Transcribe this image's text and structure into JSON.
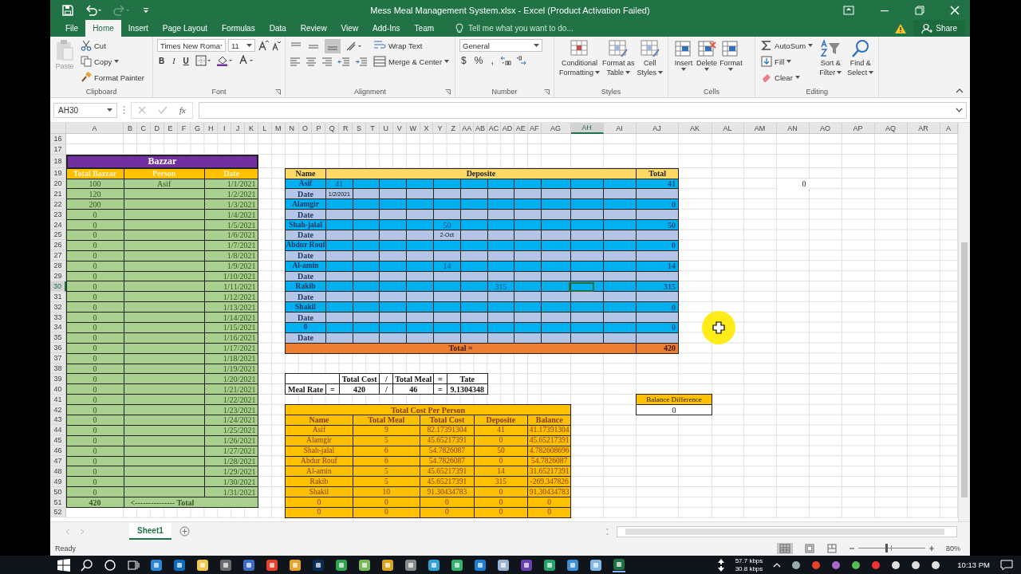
{
  "title_bar": {
    "title": "Mess Meal Management System.xlsx - Excel (Product Activation Failed)"
  },
  "tabs": [
    {
      "label": "File",
      "selected": false
    },
    {
      "label": "Home",
      "selected": true
    },
    {
      "label": "Insert",
      "selected": false
    },
    {
      "label": "Page Layout",
      "selected": false
    },
    {
      "label": "Formulas",
      "selected": false
    },
    {
      "label": "Data",
      "selected": false
    },
    {
      "label": "Review",
      "selected": false
    },
    {
      "label": "View",
      "selected": false
    },
    {
      "label": "Add-Ins",
      "selected": false
    },
    {
      "label": "Team",
      "selected": false
    }
  ],
  "tell_me": {
    "placeholder": "Tell me what you want to do..."
  },
  "share": "Share",
  "ribbon": {
    "clipboard": {
      "label": "Clipboard",
      "paste": "Paste",
      "cut": "Cut",
      "copy": "Copy",
      "format_painter": "Format Painter"
    },
    "font": {
      "label": "Font",
      "font_name": "Times New Roma",
      "font_size": "11",
      "bold": "B",
      "italic": "I",
      "underline": "U"
    },
    "alignment": {
      "label": "Alignment",
      "wrap_text": "Wrap Text",
      "merge_center": "Merge & Center"
    },
    "number": {
      "label": "Number",
      "format": "General",
      "currency": "$",
      "percent": "%",
      "comma": ","
    },
    "styles": {
      "label": "Styles",
      "buttons": [
        [
          "Conditional",
          "Formatting"
        ],
        [
          "Format as",
          "Table"
        ],
        [
          "Cell",
          "Styles"
        ]
      ]
    },
    "cells": {
      "label": "Cells",
      "buttons": [
        "Insert",
        "Delete",
        "Format"
      ]
    },
    "editing": {
      "label": "Editing",
      "autosum": "AutoSum",
      "fill": "Fill",
      "clear": "Clear",
      "buttons": [
        [
          "Sort &",
          "Filter"
        ],
        [
          "Find &",
          "Select"
        ]
      ]
    }
  },
  "formula_bar": {
    "name_box": "AH30",
    "fx": "fx"
  },
  "sheet": {
    "columns": [
      {
        "label": "A",
        "selected": false
      },
      {
        "label": "B",
        "selected": false
      },
      {
        "label": "C",
        "selected": false
      },
      {
        "label": "D",
        "selected": false
      },
      {
        "label": "E",
        "selected": false
      },
      {
        "label": "F",
        "selected": false
      },
      {
        "label": "G",
        "selected": false
      },
      {
        "label": "H",
        "selected": false
      },
      {
        "label": "I",
        "selected": false
      },
      {
        "label": "J",
        "selected": false
      },
      {
        "label": "K",
        "selected": false
      },
      {
        "label": "L",
        "selected": false
      },
      {
        "label": "M",
        "selected": false
      },
      {
        "label": "N",
        "selected": false
      },
      {
        "label": "O",
        "selected": false
      },
      {
        "label": "P",
        "selected": false
      },
      {
        "label": "Q",
        "selected": false
      },
      {
        "label": "R",
        "selected": false
      },
      {
        "label": "S",
        "selected": false
      },
      {
        "label": "T",
        "selected": false
      },
      {
        "label": "U",
        "selected": false
      },
      {
        "label": "V",
        "selected": false
      },
      {
        "label": "W",
        "selected": false
      },
      {
        "label": "X",
        "selected": false
      },
      {
        "label": "Y",
        "selected": false
      },
      {
        "label": "Z",
        "selected": false
      },
      {
        "label": "AA",
        "selected": false
      },
      {
        "label": "AB",
        "selected": false
      },
      {
        "label": "AC",
        "selected": false
      },
      {
        "label": "AD",
        "selected": false
      },
      {
        "label": "AE",
        "selected": false
      },
      {
        "label": "AF",
        "selected": false
      },
      {
        "label": "AG",
        "selected": false
      },
      {
        "label": "AH",
        "selected": true
      },
      {
        "label": "AI",
        "selected": false
      },
      {
        "label": "AJ",
        "selected": false
      },
      {
        "label": "AK",
        "selected": false
      },
      {
        "label": "AL",
        "selected": false
      },
      {
        "label": "AM",
        "selected": false
      },
      {
        "label": "AN",
        "selected": false
      },
      {
        "label": "AO",
        "selected": false
      },
      {
        "label": "AP",
        "selected": false
      },
      {
        "label": "AQ",
        "selected": false
      },
      {
        "label": "AR",
        "selected": false
      },
      {
        "label": "A",
        "selected": false
      }
    ],
    "rows": [
      {
        "label": "16",
        "selected": false
      },
      {
        "label": "17",
        "selected": false
      },
      {
        "label": "18",
        "selected": false
      },
      {
        "label": "19",
        "selected": false
      },
      {
        "label": "20",
        "selected": false
      },
      {
        "label": "21",
        "selected": false
      },
      {
        "label": "22",
        "selected": false
      },
      {
        "label": "23",
        "selected": false
      },
      {
        "label": "24",
        "selected": false
      },
      {
        "label": "25",
        "selected": false
      },
      {
        "label": "26",
        "selected": false
      },
      {
        "label": "27",
        "selected": false
      },
      {
        "label": "28",
        "selected": false
      },
      {
        "label": "29",
        "selected": false
      },
      {
        "label": "30",
        "selected": true
      },
      {
        "label": "31",
        "selected": false
      },
      {
        "label": "32",
        "selected": false
      },
      {
        "label": "33",
        "selected": false
      },
      {
        "label": "34",
        "selected": false
      },
      {
        "label": "35",
        "selected": false
      },
      {
        "label": "36",
        "selected": false
      },
      {
        "label": "37",
        "selected": false
      },
      {
        "label": "38",
        "selected": false
      },
      {
        "label": "39",
        "selected": false
      },
      {
        "label": "40",
        "selected": false
      },
      {
        "label": "41",
        "selected": false
      },
      {
        "label": "42",
        "selected": false
      },
      {
        "label": "43",
        "selected": false
      },
      {
        "label": "44",
        "selected": false
      },
      {
        "label": "45",
        "selected": false
      },
      {
        "label": "46",
        "selected": false
      },
      {
        "label": "47",
        "selected": false
      },
      {
        "label": "48",
        "selected": false
      },
      {
        "label": "49",
        "selected": false
      },
      {
        "label": "50",
        "selected": false
      },
      {
        "label": "51",
        "selected": false
      },
      {
        "label": "52",
        "selected": false
      }
    ],
    "loose_cell": {
      "value": "0"
    }
  },
  "bazzar": {
    "title": "Bazzar",
    "columns": [
      "Total Bazzar",
      "Person",
      "Date"
    ],
    "rows": [
      {
        "total": "100",
        "person": "Asif",
        "date": "1/1/2021"
      },
      {
        "total": "120",
        "date": "1/2/2021"
      },
      {
        "total": "200",
        "date": "1/3/2021"
      },
      {
        "total": "0",
        "date": "1/4/2021"
      },
      {
        "total": "0",
        "date": "1/5/2021"
      },
      {
        "total": "0",
        "date": "1/6/2021"
      },
      {
        "total": "0",
        "date": "1/7/2021"
      },
      {
        "total": "0",
        "date": "1/8/2021"
      },
      {
        "total": "0",
        "date": "1/9/2021"
      },
      {
        "total": "0",
        "date": "1/10/2021"
      },
      {
        "total": "0",
        "date": "1/11/2021"
      },
      {
        "total": "0",
        "date": "1/12/2021"
      },
      {
        "total": "0",
        "date": "1/13/2021"
      },
      {
        "total": "0",
        "date": "1/14/2021"
      },
      {
        "total": "0",
        "date": "1/15/2021"
      },
      {
        "total": "0",
        "date": "1/16/2021"
      },
      {
        "total": "0",
        "date": "1/17/2021"
      },
      {
        "total": "0",
        "date": "1/18/2021"
      },
      {
        "total": "0",
        "date": "1/19/2021"
      },
      {
        "total": "0",
        "date": "1/20/2021"
      },
      {
        "total": "0",
        "date": "1/21/2021"
      },
      {
        "total": "0",
        "date": "1/22/2021"
      },
      {
        "total": "0",
        "date": "1/23/2021"
      },
      {
        "total": "0",
        "date": "1/24/2021"
      },
      {
        "total": "0",
        "date": "1/25/2021"
      },
      {
        "total": "0",
        "date": "1/26/2021"
      },
      {
        "total": "0",
        "date": "1/27/2021"
      },
      {
        "total": "0",
        "date": "1/28/2021"
      },
      {
        "total": "0",
        "date": "1/29/2021"
      },
      {
        "total": "0",
        "date": "1/30/2021"
      },
      {
        "total": "0",
        "date": "1/31/2021"
      }
    ],
    "footer": {
      "total": "420",
      "label": "<--------------- Total"
    }
  },
  "deposit_table": {
    "headers": {
      "name": "Name",
      "deposit": "Deposite",
      "total": "Total"
    },
    "people": [
      {
        "name": "Asif",
        "amounts": [
          {
            "kind": "value",
            "value": "41"
          },
          {
            "kind": "blank"
          },
          {
            "kind": "blank"
          },
          {
            "kind": "blank"
          },
          {
            "kind": "blank"
          },
          {
            "kind": "blank"
          },
          {
            "kind": "blank"
          },
          {
            "kind": "blank"
          },
          {
            "kind": "blank"
          },
          {
            "kind": "blank"
          },
          {
            "kind": "blank"
          }
        ],
        "total": "41",
        "date_label": "Date",
        "dates": [
          {
            "kind": "value",
            "value": "1/2/2021"
          },
          {
            "kind": "blank"
          },
          {
            "kind": "blank"
          },
          {
            "kind": "blank"
          },
          {
            "kind": "blank"
          },
          {
            "kind": "blank"
          },
          {
            "kind": "blank"
          },
          {
            "kind": "blank"
          },
          {
            "kind": "blank"
          },
          {
            "kind": "blank"
          },
          {
            "kind": "blank"
          }
        ]
      },
      {
        "name": "Alamgir",
        "amounts": [
          {
            "kind": "blank"
          },
          {
            "kind": "blank"
          },
          {
            "kind": "blank"
          },
          {
            "kind": "blank"
          },
          {
            "kind": "blank"
          },
          {
            "kind": "blank"
          },
          {
            "kind": "blank"
          },
          {
            "kind": "blank"
          },
          {
            "kind": "blank"
          },
          {
            "kind": "blank"
          },
          {
            "kind": "blank"
          }
        ],
        "total": "0",
        "date_label": "Date",
        "dates": [
          {
            "kind": "blank"
          },
          {
            "kind": "blank"
          },
          {
            "kind": "blank"
          },
          {
            "kind": "blank"
          },
          {
            "kind": "blank"
          },
          {
            "kind": "blank"
          },
          {
            "kind": "blank"
          },
          {
            "kind": "blank"
          },
          {
            "kind": "blank"
          },
          {
            "kind": "blank"
          },
          {
            "kind": "blank"
          }
        ]
      },
      {
        "name": "Shah-jalal",
        "amounts": [
          {
            "kind": "blank"
          },
          {
            "kind": "blank"
          },
          {
            "kind": "blank"
          },
          {
            "kind": "blank"
          },
          {
            "kind": "value",
            "value": "50"
          },
          {
            "kind": "blank"
          },
          {
            "kind": "blank"
          },
          {
            "kind": "blank"
          },
          {
            "kind": "blank"
          },
          {
            "kind": "blank"
          },
          {
            "kind": "blank"
          }
        ],
        "total": "50",
        "date_label": "Date",
        "dates": [
          {
            "kind": "blank"
          },
          {
            "kind": "blank"
          },
          {
            "kind": "blank"
          },
          {
            "kind": "blank"
          },
          {
            "kind": "value",
            "value": "2-Oct"
          },
          {
            "kind": "blank"
          },
          {
            "kind": "blank"
          },
          {
            "kind": "blank"
          },
          {
            "kind": "blank"
          },
          {
            "kind": "blank"
          },
          {
            "kind": "blank"
          }
        ]
      },
      {
        "name": "Abdur Rouf",
        "amounts": [
          {
            "kind": "blank"
          },
          {
            "kind": "blank"
          },
          {
            "kind": "blank"
          },
          {
            "kind": "blank"
          },
          {
            "kind": "blank"
          },
          {
            "kind": "blank"
          },
          {
            "kind": "blank"
          },
          {
            "kind": "blank"
          },
          {
            "kind": "blank"
          },
          {
            "kind": "blank"
          },
          {
            "kind": "blank"
          }
        ],
        "total": "0",
        "date_label": "Date",
        "dates": [
          {
            "kind": "blank"
          },
          {
            "kind": "blank"
          },
          {
            "kind": "blank"
          },
          {
            "kind": "blank"
          },
          {
            "kind": "blank"
          },
          {
            "kind": "blank"
          },
          {
            "kind": "blank"
          },
          {
            "kind": "blank"
          },
          {
            "kind": "blank"
          },
          {
            "kind": "blank"
          },
          {
            "kind": "blank"
          }
        ]
      },
      {
        "name": "Al-amin",
        "amounts": [
          {
            "kind": "blank"
          },
          {
            "kind": "blank"
          },
          {
            "kind": "blank"
          },
          {
            "kind": "blank"
          },
          {
            "kind": "value",
            "value": "14"
          },
          {
            "kind": "blank"
          },
          {
            "kind": "blank"
          },
          {
            "kind": "blank"
          },
          {
            "kind": "blank"
          },
          {
            "kind": "blank"
          },
          {
            "kind": "blank"
          }
        ],
        "total": "14",
        "date_label": "Date",
        "dates": [
          {
            "kind": "blank"
          },
          {
            "kind": "blank"
          },
          {
            "kind": "blank"
          },
          {
            "kind": "blank"
          },
          {
            "kind": "blank"
          },
          {
            "kind": "blank"
          },
          {
            "kind": "blank"
          },
          {
            "kind": "blank"
          },
          {
            "kind": "blank"
          },
          {
            "kind": "blank"
          },
          {
            "kind": "blank"
          }
        ]
      },
      {
        "name": "Rakib",
        "amounts": [
          {
            "kind": "blank"
          },
          {
            "kind": "blank"
          },
          {
            "kind": "blank"
          },
          {
            "kind": "blank"
          },
          {
            "kind": "blank"
          },
          {
            "kind": "blank"
          },
          {
            "kind": "value",
            "value": "315"
          },
          {
            "kind": "blank"
          },
          {
            "kind": "blank"
          },
          {
            "kind": "blank"
          },
          {
            "kind": "blank"
          }
        ],
        "total": "315",
        "date_label": "Date",
        "dates": [
          {
            "kind": "blank"
          },
          {
            "kind": "blank"
          },
          {
            "kind": "blank"
          },
          {
            "kind": "blank"
          },
          {
            "kind": "blank"
          },
          {
            "kind": "blank"
          },
          {
            "kind": "blank"
          },
          {
            "kind": "blank"
          },
          {
            "kind": "blank"
          },
          {
            "kind": "blank"
          },
          {
            "kind": "blank"
          }
        ]
      },
      {
        "name": "Shakil",
        "amounts": [
          {
            "kind": "blank"
          },
          {
            "kind": "blank"
          },
          {
            "kind": "blank"
          },
          {
            "kind": "blank"
          },
          {
            "kind": "blank"
          },
          {
            "kind": "blank"
          },
          {
            "kind": "blank"
          },
          {
            "kind": "blank"
          },
          {
            "kind": "blank"
          },
          {
            "kind": "blank"
          },
          {
            "kind": "blank"
          }
        ],
        "total": "0",
        "date_label": "Date",
        "dates": [
          {
            "kind": "blank"
          },
          {
            "kind": "blank"
          },
          {
            "kind": "blank"
          },
          {
            "kind": "blank"
          },
          {
            "kind": "blank"
          },
          {
            "kind": "blank"
          },
          {
            "kind": "blank"
          },
          {
            "kind": "blank"
          },
          {
            "kind": "blank"
          },
          {
            "kind": "blank"
          },
          {
            "kind": "blank"
          }
        ]
      },
      {
        "name": "0",
        "amounts": [
          {
            "kind": "blank"
          },
          {
            "kind": "blank"
          },
          {
            "kind": "blank"
          },
          {
            "kind": "blank"
          },
          {
            "kind": "blank"
          },
          {
            "kind": "blank"
          },
          {
            "kind": "blank"
          },
          {
            "kind": "blank"
          },
          {
            "kind": "blank"
          },
          {
            "kind": "blank"
          },
          {
            "kind": "blank"
          }
        ],
        "total": "0",
        "date_label": "Date",
        "dates": [
          {
            "kind": "blank"
          },
          {
            "kind": "blank"
          },
          {
            "kind": "blank"
          },
          {
            "kind": "blank"
          },
          {
            "kind": "blank"
          },
          {
            "kind": "blank"
          },
          {
            "kind": "blank"
          },
          {
            "kind": "blank"
          },
          {
            "kind": "blank"
          },
          {
            "kind": "blank"
          },
          {
            "kind": "blank"
          }
        ]
      }
    ],
    "total_label": "Total =",
    "grand_total": "420"
  },
  "meal_rate": {
    "header": [
      "Total Cost",
      "/",
      "Total Meal",
      "=",
      "Tate"
    ],
    "row": [
      "Meal Rate",
      "=",
      "420",
      "/",
      "46",
      "=",
      "9.1304348"
    ]
  },
  "balance_difference": {
    "label": "Balance Difference",
    "value": "0"
  },
  "cost_per_person": {
    "title": "Total Cost Per Person",
    "columns": [
      "Name",
      "Total Meal",
      "Total Cost",
      "Deposite",
      "Balance"
    ],
    "rows": [
      [
        "Asif",
        "9",
        "82.17391304",
        "41",
        "41.17391304"
      ],
      [
        "Alamgir",
        "5",
        "45.65217391",
        "0",
        "45.65217391"
      ],
      [
        "Shah-jalal",
        "6",
        "54.7826087",
        "50",
        "4.782608696"
      ],
      [
        "Abdur Rouf",
        "6",
        "54.7826087",
        "0",
        "54.7826087"
      ],
      [
        "Al-amin",
        "5",
        "45.65217391",
        "14",
        "31.65217391"
      ],
      [
        "Rakib",
        "5",
        "45.65217391",
        "315",
        "-269.347826"
      ],
      [
        "Shakil",
        "10",
        "91.30434783",
        "0",
        "91.30434783"
      ],
      [
        "0",
        "0",
        "0",
        "0",
        "0"
      ],
      [
        "0",
        "0",
        "0",
        "0",
        "0"
      ]
    ]
  },
  "sheet_tabs": [
    {
      "label": "Sheet1",
      "selected": true
    }
  ],
  "status_bar": {
    "status": "Ready",
    "zoom": {
      "reading": "80%",
      "level": 0.4
    }
  },
  "taskbar": {
    "upload": "57.7 kbps",
    "download": "30.8 kbps",
    "time": "10:13 PM"
  }
}
